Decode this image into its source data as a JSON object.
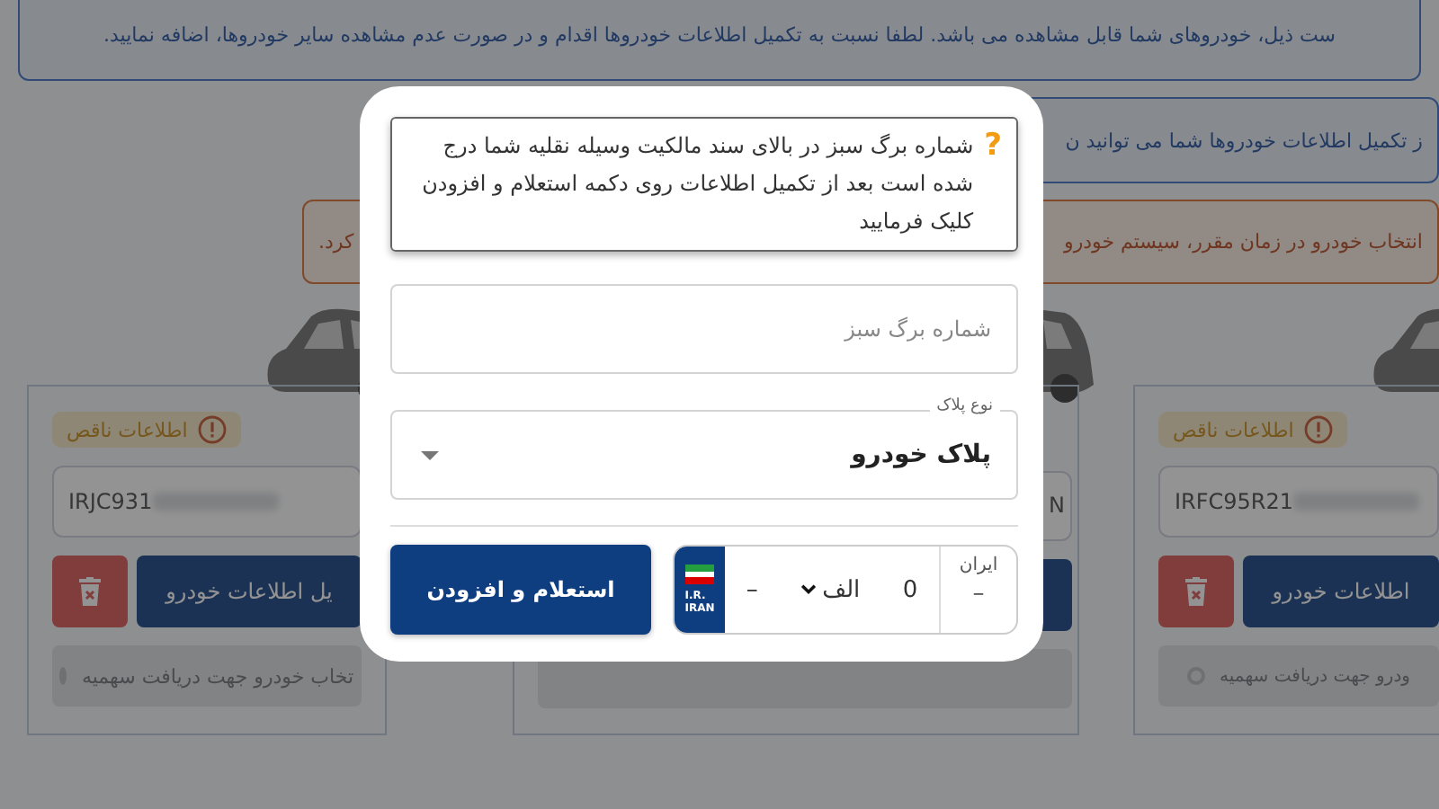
{
  "notices": [
    {
      "kind": "info",
      "parts": [
        "ست ذیل، خودروهای شما قابل مشاهده می باشد. لطفا نسبت به تکمیل اطلاعات خودروها اقدام و در صورت عدم مشاهده سایر خودروها، اضافه نمایید."
      ]
    },
    {
      "kind": "info",
      "parts": [
        "ز تکمیل اطلاعات خودروها شما می توانید ن"
      ]
    },
    {
      "kind": "warning",
      "parts": [
        "انتخاب خودرو در زمان مقرر، سیستم خودرو",
        "کرد."
      ]
    }
  ],
  "cards": [
    {
      "kind": "full",
      "badge": "اطلاعات ناقص",
      "vin": "IRFC95R21",
      "vin_redacted": true,
      "edit_label": "اطلاعات خودرو",
      "select_label": "ودرو جهت دریافت سهمیه"
    },
    {
      "kind": "hidden",
      "vin": "N",
      "vin_redacted": false
    },
    {
      "kind": "full",
      "badge": "اطلاعات ناقص",
      "vin": "IRJC931",
      "vin_redacted": true,
      "edit_label": "یل اطلاعات خودرو",
      "select_label": "تخاب خودرو جهت دریافت سهمیه"
    }
  ],
  "dialog": {
    "hint_icon": "?",
    "hint": "شماره برگ سبز در بالای سند مالکیت وسیله نقلیه شما درج شده است بعد از تکمیل اطلاعات روی دکمه استعلام و افزودن کلیک فرمایید",
    "green_sheet": {
      "placeholder": "شماره برگ سبز"
    },
    "plate_type": {
      "label": "نوع پلاک",
      "value": "پلاک خودرو"
    },
    "plate": {
      "country_lines": [
        "I.R.",
        "IRAN"
      ],
      "segments": [
        {
          "kind": "input",
          "value": "0"
        },
        {
          "kind": "select",
          "value": "الف"
        },
        {
          "kind": "input",
          "value": "–"
        }
      ],
      "region_label": "ایران",
      "region_value": "–"
    },
    "submit": "استعلام و افزودن"
  }
}
